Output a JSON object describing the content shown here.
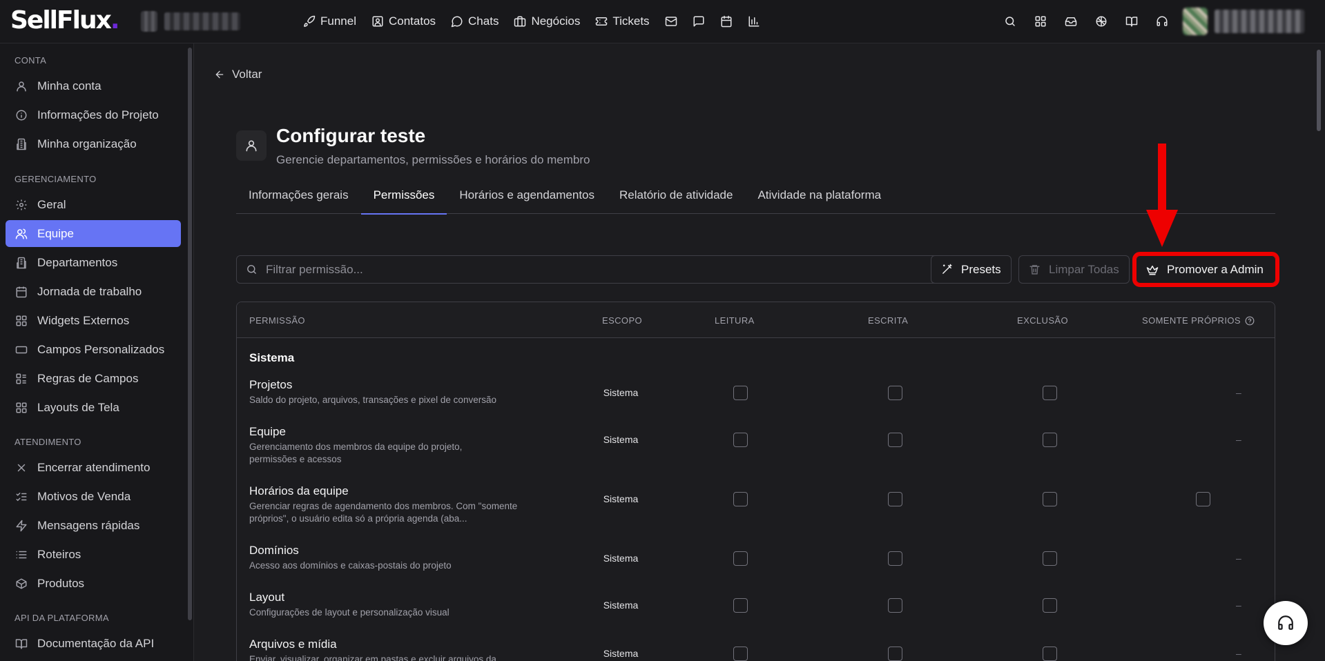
{
  "app": {
    "logo_text": "SellFlux",
    "logo_dot": "."
  },
  "topnav": {
    "items": [
      {
        "label": "Funnel",
        "icon": "rocket-icon"
      },
      {
        "label": "Contatos",
        "icon": "contact-card-icon"
      },
      {
        "label": "Chats",
        "icon": "chat-bubble-icon"
      },
      {
        "label": "Negócios",
        "icon": "briefcase-icon"
      },
      {
        "label": "Tickets",
        "icon": "ticket-icon"
      }
    ],
    "icon_buttons": [
      "mail-icon",
      "message-square-icon",
      "calendar-icon",
      "bar-chart-icon"
    ],
    "right_icons": [
      "search-icon",
      "apps-grid-icon",
      "inbox-icon",
      "brain-icon",
      "book-open-icon",
      "headset-icon"
    ]
  },
  "sidebar": {
    "sections": [
      {
        "title": "CONTA",
        "items": [
          {
            "label": "Minha conta",
            "icon": "user-icon"
          },
          {
            "label": "Informações do Projeto",
            "icon": "info-icon"
          },
          {
            "label": "Minha organização",
            "icon": "building-icon"
          }
        ]
      },
      {
        "title": "GERENCIAMENTO",
        "items": [
          {
            "label": "Geral",
            "icon": "gear-icon"
          },
          {
            "label": "Equipe",
            "icon": "users-icon",
            "active": true
          },
          {
            "label": "Departamentos",
            "icon": "building-icon"
          },
          {
            "label": "Jornada de trabalho",
            "icon": "calendar-icon"
          },
          {
            "label": "Widgets Externos",
            "icon": "widgets-icon"
          },
          {
            "label": "Campos Personalizados",
            "icon": "input-field-icon"
          },
          {
            "label": "Regras de Campos",
            "icon": "rules-list-icon"
          },
          {
            "label": "Layouts de Tela",
            "icon": "layout-grid-icon"
          }
        ]
      },
      {
        "title": "ATENDIMENTO",
        "items": [
          {
            "label": "Encerrar atendimento",
            "icon": "x-icon"
          },
          {
            "label": "Motivos de Venda",
            "icon": "checklist-icon"
          },
          {
            "label": "Mensagens rápidas",
            "icon": "lightning-icon"
          },
          {
            "label": "Roteiros",
            "icon": "list-icon"
          },
          {
            "label": "Produtos",
            "icon": "package-icon"
          }
        ]
      },
      {
        "title": "API DA PLATAFORMA",
        "items": [
          {
            "label": "Documentação da API",
            "icon": "book-icon"
          }
        ]
      }
    ]
  },
  "main": {
    "back_label": "Voltar",
    "title": "Configurar teste",
    "subtitle": "Gerencie departamentos, permissões e horários do membro",
    "tabs": [
      {
        "label": "Informações gerais"
      },
      {
        "label": "Permissões",
        "active": true
      },
      {
        "label": "Horários e agendamentos"
      },
      {
        "label": "Relatório de atividade"
      },
      {
        "label": "Atividade na plataforma"
      }
    ],
    "search_placeholder": "Filtrar permissão...",
    "presets_label": "Presets",
    "clear_label": "Limpar Todas",
    "promote_label": "Promover a Admin"
  },
  "table": {
    "headers": {
      "permission": "PERMISSÃO",
      "scope": "ESCOPO",
      "read": "LEITURA",
      "write": "ESCRITA",
      "delete": "EXCLUSÃO",
      "own_only": "SOMENTE PRÓPRIOS"
    },
    "group": "Sistema",
    "rows": [
      {
        "name": "Projetos",
        "desc": "Saldo do projeto, arquivos, transações e pixel de conversão",
        "scope": "Sistema",
        "own": "–"
      },
      {
        "name": "Equipe",
        "desc": "Gerenciamento dos membros da equipe do projeto, permissões e acessos",
        "scope": "Sistema",
        "own": "–"
      },
      {
        "name": "Horários da equipe",
        "desc": "Gerenciar regras de agendamento dos membros. Com \"somente próprios\", o usuário edita só a própria agenda (aba...",
        "scope": "Sistema",
        "own": "checkbox"
      },
      {
        "name": "Domínios",
        "desc": "Acesso aos domínios e caixas-postais do projeto",
        "scope": "Sistema",
        "own": "–"
      },
      {
        "name": "Layout",
        "desc": "Configurações de layout e personalização visual",
        "scope": "Sistema",
        "own": "–"
      },
      {
        "name": "Arquivos e mídia",
        "desc": "Enviar, visualizar, organizar em pastas e excluir arquivos da",
        "scope": "Sistema",
        "own": "–"
      }
    ]
  },
  "colors": {
    "accent": "#6674f4",
    "background": "#1c1c1f",
    "highlight_annotation": "#ee0000"
  }
}
